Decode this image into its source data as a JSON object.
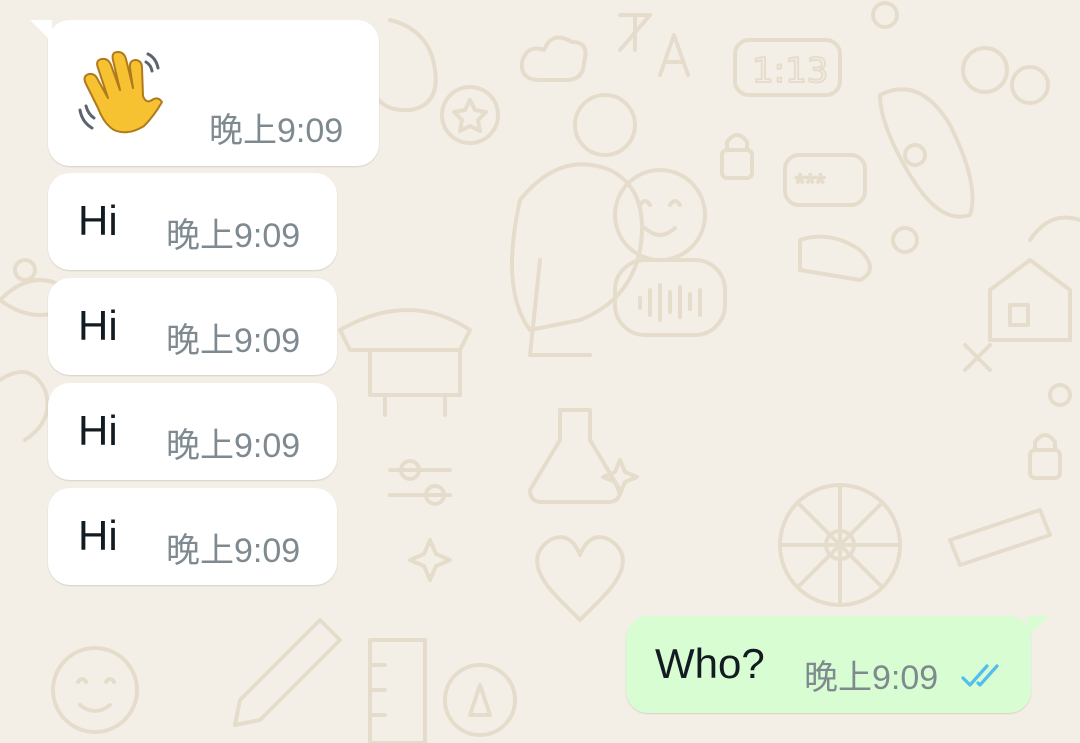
{
  "chat": {
    "messages": [
      {
        "direction": "incoming",
        "kind": "emoji",
        "icon": "waving-hand-icon",
        "time": "晚上9:09"
      },
      {
        "direction": "incoming",
        "kind": "text",
        "text": "Hi",
        "time": "晚上9:09"
      },
      {
        "direction": "incoming",
        "kind": "text",
        "text": "Hi",
        "time": "晚上9:09"
      },
      {
        "direction": "incoming",
        "kind": "text",
        "text": "Hi",
        "time": "晚上9:09"
      },
      {
        "direction": "incoming",
        "kind": "text",
        "text": "Hi",
        "time": "晚上9:09"
      },
      {
        "direction": "outgoing",
        "kind": "text",
        "text": "Who?",
        "time": "晚上9:09",
        "status": "read",
        "status_icon": "double-check-read-icon"
      }
    ]
  },
  "colors": {
    "wallpaper": "#f4efe6",
    "doodle": "#e6dccc",
    "incoming_bubble": "#ffffff",
    "outgoing_bubble": "#d9fdd3",
    "timestamp": "#7e8a90",
    "read_ticks": "#53bdeb"
  }
}
